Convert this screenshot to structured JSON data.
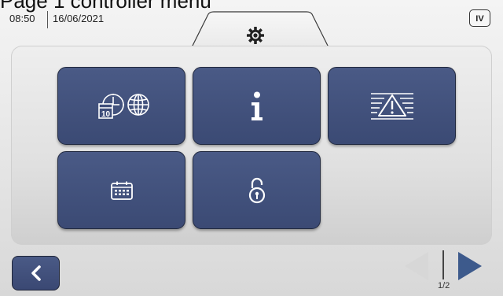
{
  "caption": "Page 1 controller menu",
  "header": {
    "time": "08:50",
    "date": "16/06/2021",
    "badge": "IV",
    "icon": "gear-icon"
  },
  "tiles": [
    {
      "name": "date-time-region-tile",
      "icon": "calendar-clock-globe-icon"
    },
    {
      "name": "info-tile",
      "icon": "info-icon"
    },
    {
      "name": "alarm-log-tile",
      "icon": "warning-list-icon"
    },
    {
      "name": "calendar-tile",
      "icon": "calendar-icon"
    },
    {
      "name": "lock-tile",
      "icon": "unlock-icon"
    }
  ],
  "navigation": {
    "back": {
      "icon": "chevron-left-icon"
    },
    "prev": {
      "icon": "triangle-left-icon",
      "enabled": false
    },
    "next": {
      "icon": "triangle-right-icon",
      "enabled": true
    },
    "page_indicator": "1/2"
  },
  "colors": {
    "tile": "#3f4e7a",
    "tile_border": "#222a40",
    "next_arrow": "#3d5a8c",
    "prev_arrow_disabled": "#d7d7d7"
  }
}
